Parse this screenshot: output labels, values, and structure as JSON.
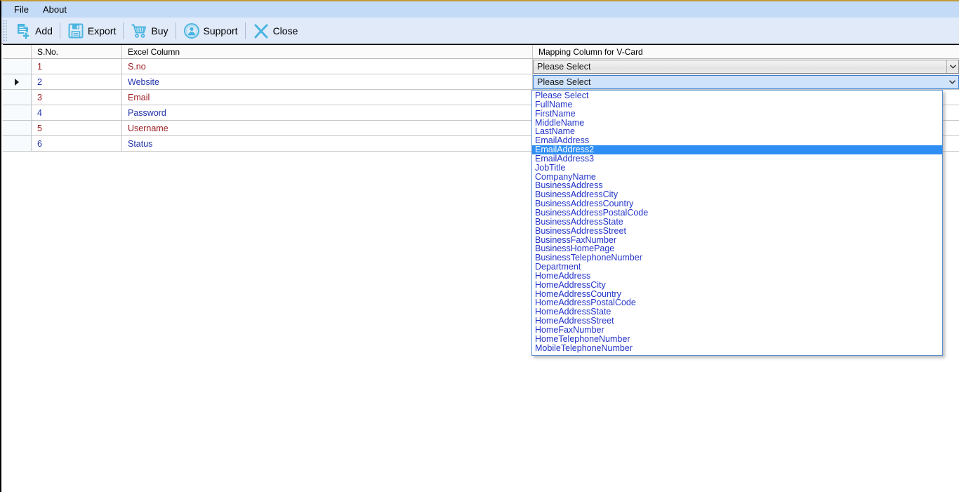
{
  "window": {
    "title_bar_accent": "#c49a34"
  },
  "menu": {
    "items": [
      {
        "label": "File",
        "name": "menu-file"
      },
      {
        "label": "About",
        "name": "menu-about"
      }
    ]
  },
  "toolbar": {
    "buttons": [
      {
        "label": "Add",
        "icon": "add-document-icon",
        "name": "toolbar-add-button"
      },
      {
        "label": "Export",
        "icon": "floppy-save-icon",
        "name": "toolbar-export-button"
      },
      {
        "label": "Buy",
        "icon": "shopping-cart-icon",
        "name": "toolbar-buy-button"
      },
      {
        "label": "Support",
        "icon": "support-person-icon",
        "name": "toolbar-support-button"
      },
      {
        "label": "Close",
        "icon": "close-x-icon",
        "name": "toolbar-close-button"
      }
    ]
  },
  "grid": {
    "columns": [
      {
        "key": "rowhdr",
        "label": ""
      },
      {
        "key": "sno",
        "label": "S.No."
      },
      {
        "key": "excel",
        "label": "Excel Column"
      },
      {
        "key": "map",
        "label": "Mapping Column for V-Card"
      }
    ],
    "rows": [
      {
        "sno": "1",
        "excel": "S.no",
        "mapping_value": "Please Select",
        "selected_row": false,
        "combo_open": false
      },
      {
        "sno": "2",
        "excel": "Website",
        "mapping_value": "Please Select",
        "selected_row": true,
        "combo_open": true
      },
      {
        "sno": "3",
        "excel": "Email",
        "mapping_value": "",
        "selected_row": false,
        "combo_open": false
      },
      {
        "sno": "4",
        "excel": "Password",
        "mapping_value": "",
        "selected_row": false,
        "combo_open": false
      },
      {
        "sno": "5",
        "excel": "Username",
        "mapping_value": "",
        "selected_row": false,
        "combo_open": false
      },
      {
        "sno": "6",
        "excel": "Status",
        "mapping_value": "",
        "selected_row": false,
        "combo_open": false
      }
    ]
  },
  "dropdown": {
    "open_for_row": 2,
    "highlighted": "EmailAddress2",
    "options": [
      "Please Select",
      "FullName",
      "FirstName",
      "MiddleName",
      "LastName",
      "EmailAddress",
      "EmailAddress2",
      "EmailAddress3",
      "JobTitle",
      "CompanyName",
      "BusinessAddress",
      "BusinessAddressCity",
      "BusinessAddressCountry",
      "BusinessAddressPostalCode",
      "BusinessAddressState",
      "BusinessAddressStreet",
      "BusinessFaxNumber",
      "BusinessHomePage",
      "BusinessTelephoneNumber",
      "Department",
      "HomeAddress",
      "HomeAddressCity",
      "HomeAddressCountry",
      "HomeAddressPostalCode",
      "HomeAddressState",
      "HomeAddressStreet",
      "HomeFaxNumber",
      "HomeTelephoneNumber",
      "MobileTelephoneNumber"
    ]
  },
  "colors": {
    "menu_bar": "#c3dbf7",
    "toolbar": "#e1eaf9",
    "icon_blue": "#4bb5e0",
    "row_text_odd": "#9b1b21",
    "row_text_even": "#2233aa",
    "dropdown_text": "#2233c8",
    "selection_blue": "#2f8ef4",
    "combo_open_bg": "#cfe3fb"
  }
}
